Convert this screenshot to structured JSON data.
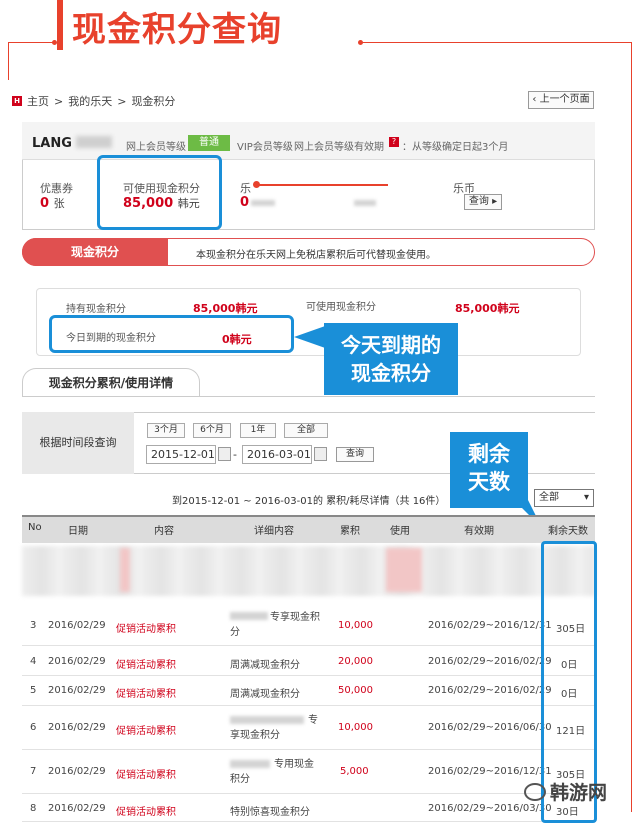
{
  "header": {
    "title": "现金积分查询"
  },
  "breadcrumb": {
    "home_icon": "H",
    "items": [
      "主页",
      "我的乐天",
      "现金积分"
    ],
    "sep": ">"
  },
  "prev_button": {
    "label": "‹ 上一个页面"
  },
  "user": {
    "name": "LANG",
    "grade_label": "网上会员等级",
    "grade_value": "普通",
    "vip_label": "VIP会员等级",
    "validity_label": "网上会员等级有效期",
    "validity_help": "?",
    "validity_value": "：从等级确定日起3个月"
  },
  "stats": {
    "coupon_label": "优惠券",
    "coupon_value": "0",
    "coupon_unit": "张",
    "cash_label": "可使用现金积分",
    "cash_value": "85,000",
    "cash_unit": "韩元",
    "third_label": "乐",
    "third_value": "0",
    "lecoin_label": "乐币",
    "lecoin_button": "查询 ▸"
  },
  "cash_banner": {
    "tab": "现金积分",
    "desc": "本现金积分在乐天网上免税店累积后可代替现金使用。"
  },
  "summary": {
    "held_label": "持有现金积分",
    "held_value": "85,000韩元",
    "usable_label": "可使用现金积分",
    "usable_value": "85,000韩元",
    "expire_label": "今日到期的现金积分",
    "expire_value": "0韩元"
  },
  "callouts": {
    "today_expire": "今天到期的\n现金积分",
    "remaining_days": "剩余\n天数"
  },
  "tab": {
    "label": "现金积分累积/使用详情"
  },
  "filter": {
    "label": "根据时间段查询",
    "periods": [
      "3个月",
      "6个月",
      "1年",
      "全部"
    ],
    "start_date": "2015-12-01",
    "end_date": "2016-03-01",
    "dash": "-",
    "query_button": "查询"
  },
  "range_text": "到2015-12-01 ~ 2016-03-01的 累积/耗尽详情（共 16件）",
  "select": {
    "value": "全部",
    "arrow": "▾"
  },
  "table": {
    "headers": [
      "No",
      "日期",
      "内容",
      "详细内容",
      "累积",
      "使用",
      "有效期",
      "剩余天数"
    ],
    "rows": [
      {
        "no": "3",
        "date": "2016/02/29",
        "content": "促销活动累积",
        "detail": "专享现金积\n分",
        "accum": "10,000",
        "use": "",
        "valid": "2016/02/29~2016/12/31",
        "remain": "305日"
      },
      {
        "no": "4",
        "date": "2016/02/29",
        "content": "促销活动累积",
        "detail": "周满减现金积分",
        "accum": "20,000",
        "use": "",
        "valid": "2016/02/29~2016/02/29",
        "remain": "0日"
      },
      {
        "no": "5",
        "date": "2016/02/29",
        "content": "促销活动累积",
        "detail": "周满减现金积分",
        "accum": "50,000",
        "use": "",
        "valid": "2016/02/29~2016/02/29",
        "remain": "0日"
      },
      {
        "no": "6",
        "date": "2016/02/29",
        "content": "促销活动累积",
        "detail": "专\n享现金积分",
        "accum": "10,000",
        "use": "",
        "valid": "2016/02/29~2016/06/30",
        "remain": "121日"
      },
      {
        "no": "7",
        "date": "2016/02/29",
        "content": "促销活动累积",
        "detail": "专用现金\n积分",
        "accum": "5,000",
        "use": "",
        "valid": "2016/02/29~2016/12/31",
        "remain": "305日"
      },
      {
        "no": "8",
        "date": "2016/02/29",
        "content": "促销活动累积",
        "detail": "特别惊喜现金积分",
        "accum": "",
        "use": "",
        "valid": "2016/02/29~2016/03/30",
        "remain": "30日"
      }
    ]
  },
  "watermark": {
    "text": "韩游网"
  },
  "colors": {
    "accent": "#e8412c",
    "highlight": "#1a8fd8",
    "grade": "#6dbb45",
    "value_red": "#d0021b"
  }
}
